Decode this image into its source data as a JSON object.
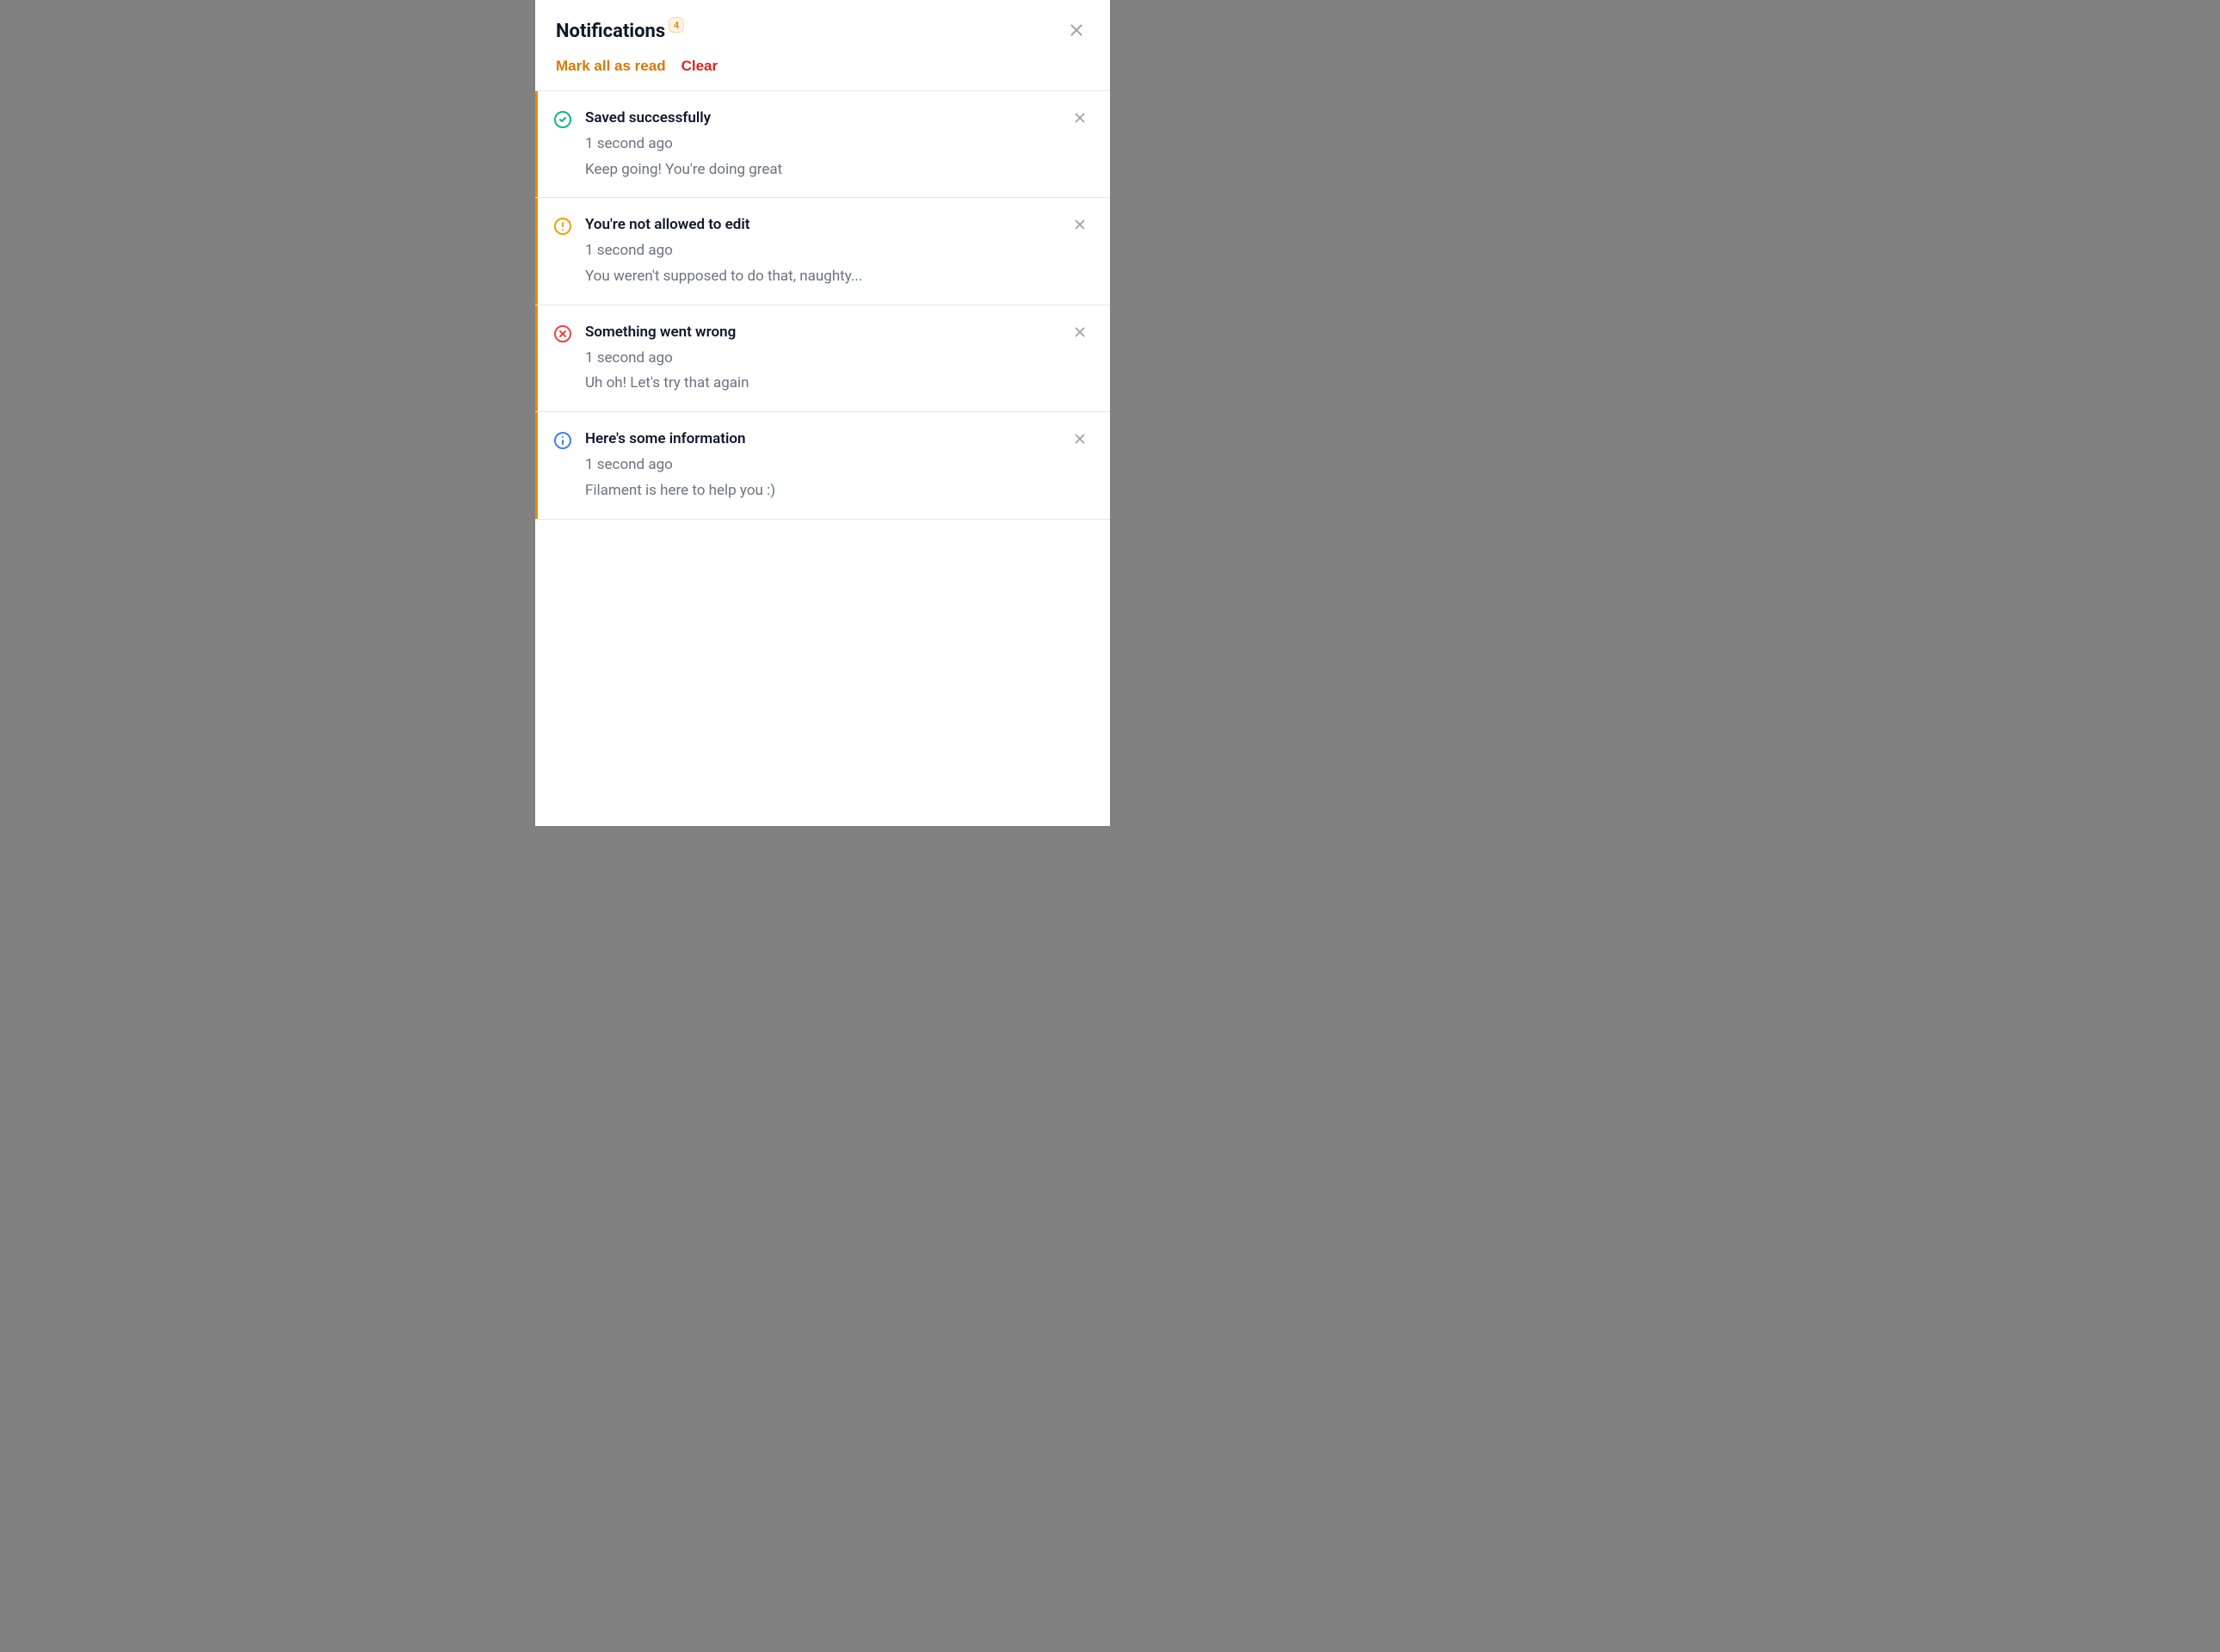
{
  "header": {
    "title": "Notifications",
    "badge": "4",
    "mark_all_label": "Mark all as read",
    "clear_label": "Clear"
  },
  "items": [
    {
      "icon": "success",
      "title": "Saved successfully",
      "time": "1 second ago",
      "desc": "Keep going! You're doing great"
    },
    {
      "icon": "warning",
      "title": "You're not allowed to edit",
      "time": "1 second ago",
      "desc": "You weren't supposed to do that, naughty..."
    },
    {
      "icon": "error",
      "title": "Something went wrong",
      "time": "1 second ago",
      "desc": "Uh oh! Let's try that again"
    },
    {
      "icon": "info",
      "title": "Here's some information",
      "time": "1 second ago",
      "desc": "Filament is here to help you :)"
    }
  ]
}
